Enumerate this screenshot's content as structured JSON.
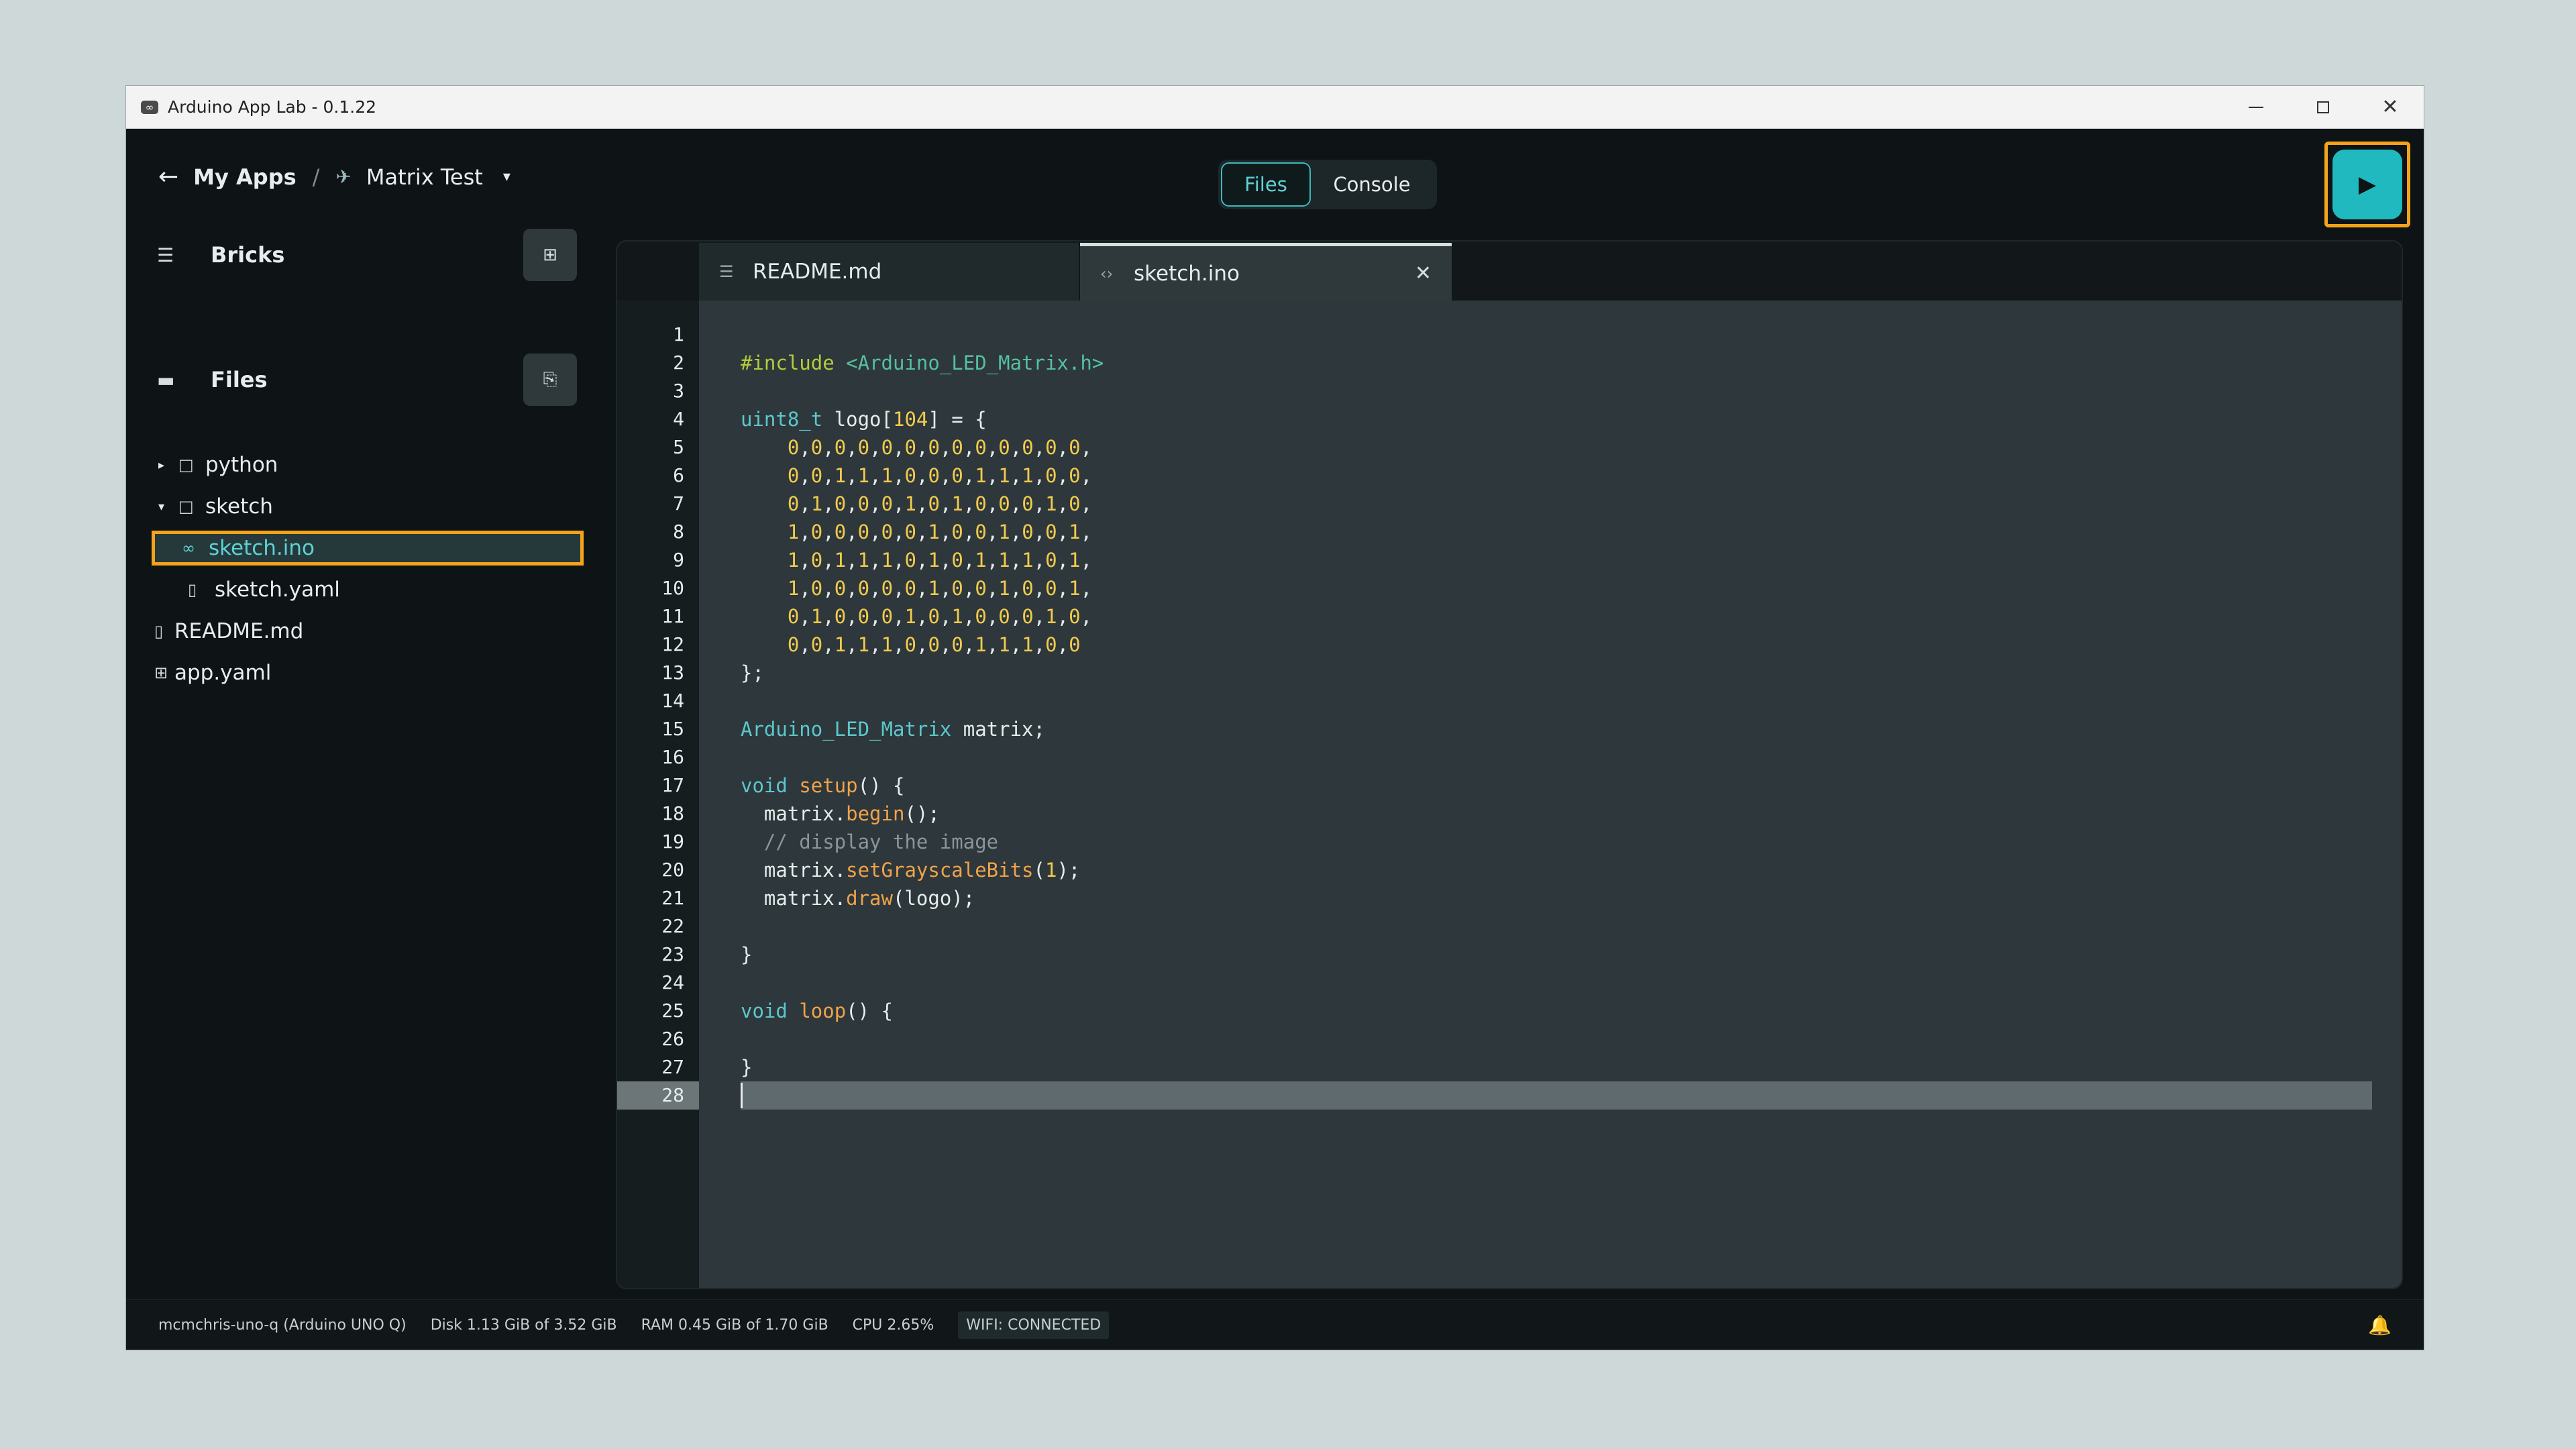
{
  "window": {
    "title": "Arduino App Lab - 0.1.22",
    "close_glyph": "✕"
  },
  "header": {
    "back_glyph": "←",
    "my_apps": "My Apps",
    "separator": "/",
    "app_icon_glyph": "✈",
    "app_name": "Matrix Test",
    "caret_glyph": "▾",
    "tabs": {
      "files": "Files",
      "console": "Console"
    },
    "run_glyph": "▶"
  },
  "sidebar": {
    "bricks": {
      "label": "Bricks",
      "icon_glyph": "☰",
      "button_glyph": "⊞"
    },
    "files": {
      "label": "Files",
      "icon_glyph": "▬",
      "button_glyph": "⎘"
    },
    "tree": [
      {
        "label": "python",
        "twisty": "▸",
        "icon": "□",
        "indent": 0
      },
      {
        "label": "sketch",
        "twisty": "▾",
        "icon": "□",
        "indent": 0
      },
      {
        "label": "sketch.ino",
        "twisty": "",
        "icon": "∞",
        "indent": 1,
        "selected": true
      },
      {
        "label": "sketch.yaml",
        "twisty": "",
        "icon": "▯",
        "indent": 1
      },
      {
        "label": "README.md",
        "twisty": "",
        "icon": "▯",
        "indent": -1
      },
      {
        "label": "app.yaml",
        "twisty": "",
        "icon": "⊞",
        "indent": -1
      }
    ]
  },
  "editor": {
    "tabs": [
      {
        "label": "README.md",
        "icon": "☰"
      },
      {
        "label": "sketch.ino",
        "icon": "‹›",
        "close": "✕",
        "active": true
      }
    ],
    "active_line": 28,
    "lines": [
      "",
      "#include <Arduino_LED_Matrix.h>",
      "",
      "uint8_t logo[104] = {",
      "    0,0,0,0,0,0,0,0,0,0,0,0,0,",
      "    0,0,1,1,1,0,0,0,1,1,1,0,0,",
      "    0,1,0,0,0,1,0,1,0,0,0,1,0,",
      "    1,0,0,0,0,0,1,0,0,1,0,0,1,",
      "    1,0,1,1,1,0,1,0,1,1,1,0,1,",
      "    1,0,0,0,0,0,1,0,0,1,0,0,1,",
      "    0,1,0,0,0,1,0,1,0,0,0,1,0,",
      "    0,0,1,1,1,0,0,0,1,1,1,0,0",
      "};",
      "",
      "Arduino_LED_Matrix matrix;",
      "",
      "void setup() {",
      "  matrix.begin();",
      "  // display the image",
      "  matrix.setGrayscaleBits(1);",
      "  matrix.draw(logo);",
      "",
      "}",
      "",
      "void loop() {",
      "",
      "}",
      ""
    ]
  },
  "status": {
    "device": "mcmchris-uno-q (Arduino UNO Q)",
    "disk": "Disk 1.13 GiB of 3.52 GiB",
    "ram": "RAM 0.45 GiB of 1.70 GiB",
    "cpu": "CPU 2.65%",
    "wifi": "WIFI: CONNECTED",
    "bell_glyph": "🔔"
  },
  "colors": {
    "accent": "#20b9c0",
    "focus": "#f5a31a",
    "background": "#0e1415"
  }
}
